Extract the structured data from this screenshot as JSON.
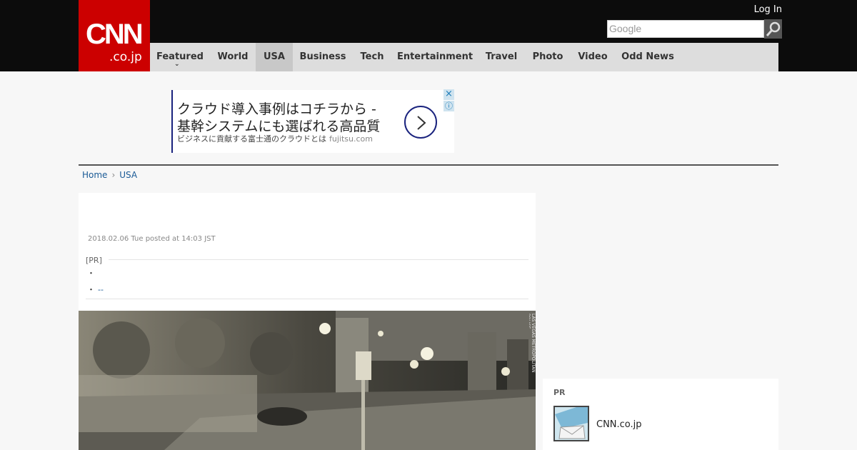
{
  "brand": {
    "logo_main": "CNN",
    "logo_sub": ".co.jp",
    "color": "#cc0000"
  },
  "header": {
    "login": "Log In",
    "search_placeholder": "Google"
  },
  "nav": {
    "items": [
      {
        "label": "Featured",
        "has_dropdown": true
      },
      {
        "label": "World"
      },
      {
        "label": "USA",
        "active": true
      },
      {
        "label": "Business"
      },
      {
        "label": "Tech"
      },
      {
        "label": "Entertainment"
      },
      {
        "label": "Travel"
      },
      {
        "label": "Photo"
      },
      {
        "label": "Video"
      },
      {
        "label": "Odd News"
      }
    ]
  },
  "ad": {
    "line1": "クラウド導入事例はコチラから -",
    "line2": "基幹システムにも選ばれる高品質",
    "line3": "ビジネスに貢献する富士通のクラウドとは",
    "domain": "fujitsu.com",
    "close_icon": "×",
    "info_icon": "ⓘ"
  },
  "breadcrumb": {
    "home": "Home",
    "current": "USA"
  },
  "article": {
    "posted": "2018.02.06 Tue posted at 14:03 JST",
    "pr_label": "[PR]",
    "bullet1": "・",
    "bullet2": "・",
    "bullet2_link": "--",
    "photo_credit": "LAS VEGAS METROPOLITAN POLICE"
  },
  "sidebar": {
    "pr_label": "PR",
    "item_name": "CNN.co.jp"
  }
}
